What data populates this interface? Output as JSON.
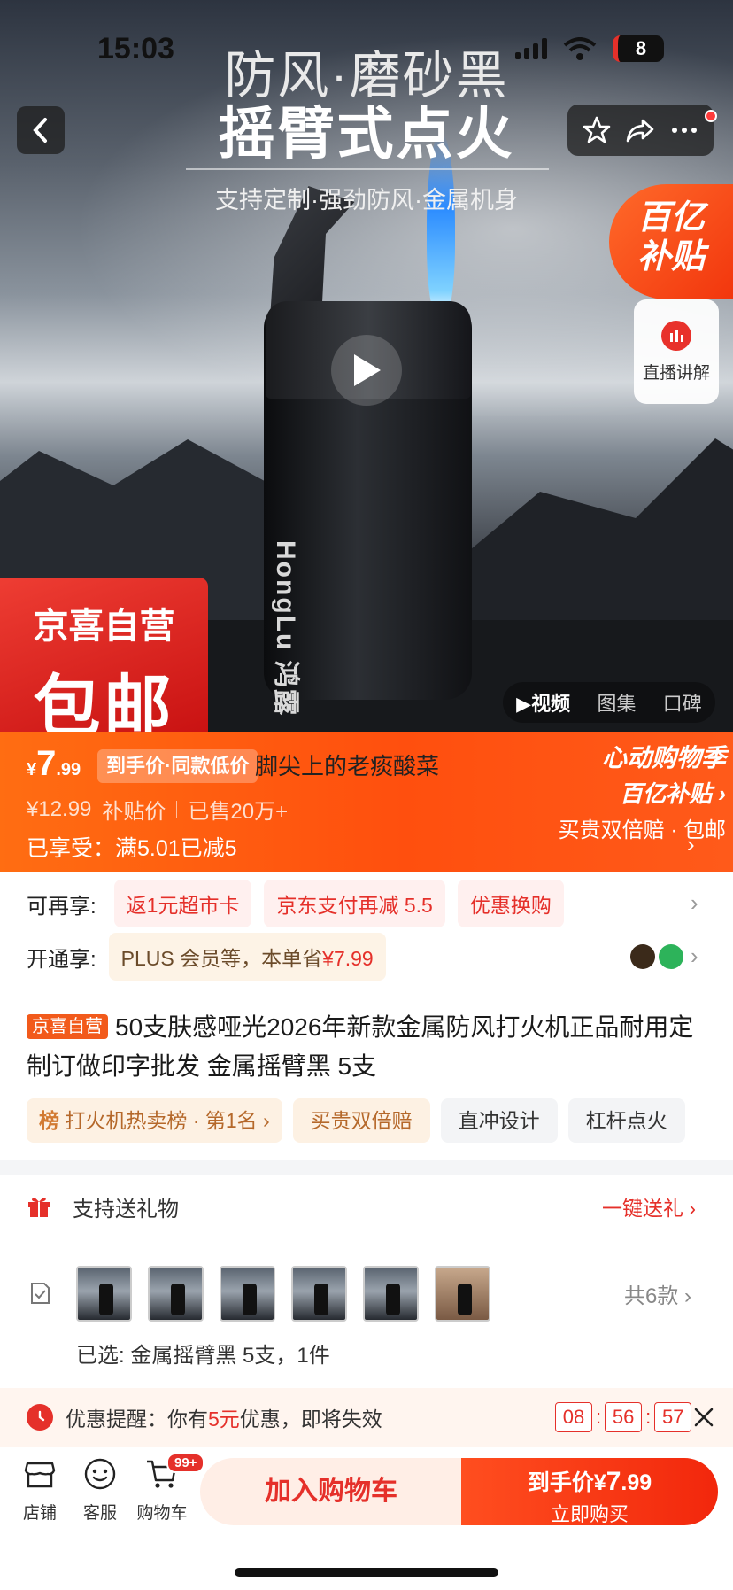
{
  "status_bar": {
    "time": "15:03",
    "battery": "8"
  },
  "hero": {
    "title_line1": "防风·磨砂黑",
    "title_line2": "摇臂式点火",
    "subtitle": "支持定制·强劲防风·金属机身",
    "lighter_brand": "HongLu 鸿露",
    "subsidy_badge_line1": "百亿",
    "subsidy_badge_line2": "补贴",
    "live_label": "直播讲解",
    "store_badge_line1": "京喜自营",
    "store_badge_line2": "包邮",
    "media_tabs": [
      "▶视频",
      "图集",
      "口碑"
    ]
  },
  "price_band": {
    "currency": "¥",
    "price_int": "7",
    "price_dec": ".99",
    "price_tag": "到手价·同款低价",
    "overlay_text": "脚尖上的老痰酸菜",
    "original_price": "¥12.99",
    "subsidy_label": "补贴价",
    "sold": "已售20万+",
    "enjoyed": "已享受：满5.01已减5",
    "promo_line1": "心动购物季",
    "promo_line2": "百亿补贴 ›",
    "promo_line3": "买贵双倍赔 · 包邮"
  },
  "benefits": {
    "label": "可再享:",
    "chips": [
      "返1元超市卡",
      "京东支付再减 5.5",
      "优惠换购"
    ]
  },
  "plus": {
    "label": "开通享:",
    "text": "PLUS 会员等，本单省",
    "amount": "¥7.99"
  },
  "product": {
    "self_tag": "京喜自营",
    "title": "50支肤感哑光2026年新款金属防风打火机正品耐用定制订做印字批发 金属摇臂黑 5支"
  },
  "tags": {
    "rank_icon": "榜",
    "rank_text": "打火机热卖榜 · 第1名 ›",
    "gold": "买贵双倍赔",
    "grey": [
      "直冲设计",
      "杠杆点火"
    ]
  },
  "gift": {
    "label": "支持送礼物",
    "link": "一键送礼 ›"
  },
  "sku": {
    "count": "共6款 ›",
    "selected": "已选:  金属摇臂黑 5支，1件"
  },
  "reminder": {
    "prefix": "优惠提醒：你有",
    "amount": "5元",
    "suffix": "优惠，即将失效",
    "timer": [
      "08",
      "56",
      "57"
    ]
  },
  "bottom_bar": {
    "store": "店铺",
    "service": "客服",
    "cart": "购物车",
    "cart_badge": "99+",
    "add_to_cart": "加入购物车",
    "buy_prefix": "到手价¥",
    "buy_int": "7",
    "buy_dec": ".99",
    "buy_now": "立即购买"
  },
  "colors": {
    "accent": "#e5302a",
    "orange": "#ff5a14",
    "gold_text": "#b5682a"
  }
}
